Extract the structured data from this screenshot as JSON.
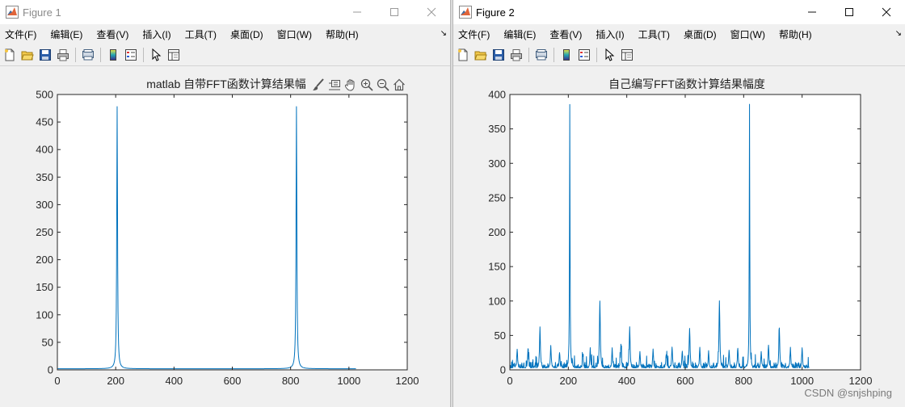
{
  "windows": [
    {
      "title": "Figure 1",
      "active": false,
      "menu": [
        "文件(F)",
        "编辑(E)",
        "查看(V)",
        "插入(I)",
        "工具(T)",
        "桌面(D)",
        "窗口(W)",
        "帮助(H)"
      ],
      "more": "↘"
    },
    {
      "title": "Figure 2",
      "active": true,
      "menu": [
        "文件(F)",
        "编辑(E)",
        "查看(V)",
        "插入(I)",
        "工具(T)",
        "桌面(D)",
        "窗口(W)",
        "帮助(H)"
      ],
      "more": "↘"
    }
  ],
  "icons": {
    "toolbar": [
      "new-figure-icon",
      "open-file-icon",
      "save-icon",
      "print-icon",
      "print-preview-icon",
      "colorbar-icon",
      "legend-icon",
      "pointer-icon",
      "property-inspector-icon"
    ],
    "axes_toolbar": [
      "brush-icon",
      "data-tips-icon",
      "pan-icon",
      "zoom-in-icon",
      "zoom-out-icon",
      "home-icon"
    ]
  },
  "colors": {
    "line": "#0072bd",
    "accent": "#0072bd"
  },
  "chart_data": [
    {
      "type": "line",
      "title": "matlab 自带FFT函数计算结果幅",
      "xlim": [
        0,
        1200
      ],
      "ylim": [
        0,
        500
      ],
      "xticks": [
        "0",
        "200",
        "400",
        "600",
        "800",
        "1000",
        "1200"
      ],
      "yticks": [
        "0",
        "50",
        "100",
        "150",
        "200",
        "250",
        "300",
        "350",
        "400",
        "450",
        "500"
      ],
      "n_points": 1024,
      "series": [
        {
          "peaks": [
            {
              "x": 205,
              "y": 478
            },
            {
              "x": 820,
              "y": 478
            }
          ],
          "baseline": 2
        }
      ]
    },
    {
      "type": "line",
      "title": "自己编写FFT函数计算结果幅度",
      "xlim": [
        0,
        1200
      ],
      "ylim": [
        0,
        400
      ],
      "xticks": [
        "0",
        "200",
        "400",
        "600",
        "800",
        "1000",
        "1200"
      ],
      "yticks": [
        "0",
        "50",
        "100",
        "150",
        "200",
        "250",
        "300",
        "350",
        "400"
      ],
      "n_points": 1024,
      "series": [
        {
          "peaks": [
            {
              "x": 205,
              "y": 385
            },
            {
              "x": 820,
              "y": 385
            },
            {
              "x": 308,
              "y": 99
            },
            {
              "x": 717,
              "y": 99
            },
            {
              "x": 103,
              "y": 60
            },
            {
              "x": 410,
              "y": 60
            },
            {
              "x": 615,
              "y": 60
            },
            {
              "x": 922,
              "y": 60
            },
            {
              "x": 25,
              "y": 30
            },
            {
              "x": 62,
              "y": 28
            },
            {
              "x": 140,
              "y": 33
            },
            {
              "x": 170,
              "y": 25
            },
            {
              "x": 250,
              "y": 22
            },
            {
              "x": 275,
              "y": 28
            },
            {
              "x": 350,
              "y": 30
            },
            {
              "x": 380,
              "y": 36
            },
            {
              "x": 445,
              "y": 25
            },
            {
              "x": 490,
              "y": 28
            },
            {
              "x": 535,
              "y": 22
            },
            {
              "x": 555,
              "y": 32
            },
            {
              "x": 590,
              "y": 26
            },
            {
              "x": 650,
              "y": 30
            },
            {
              "x": 680,
              "y": 25
            },
            {
              "x": 750,
              "y": 28
            },
            {
              "x": 780,
              "y": 30
            },
            {
              "x": 860,
              "y": 25
            },
            {
              "x": 885,
              "y": 35
            },
            {
              "x": 960,
              "y": 30
            },
            {
              "x": 1000,
              "y": 30
            }
          ],
          "noise": 8
        }
      ]
    }
  ],
  "watermark": "CSDN @snjshping"
}
